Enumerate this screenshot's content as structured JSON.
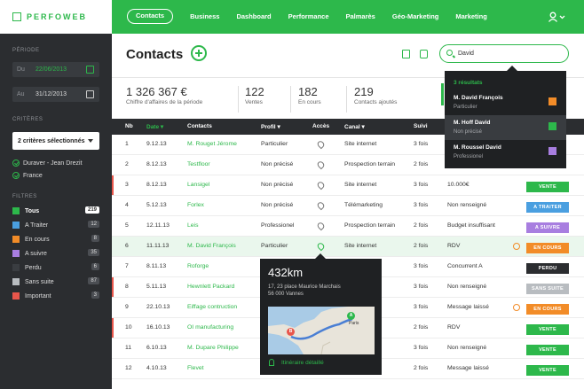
{
  "app": {
    "logo": "PERFOWEB"
  },
  "nav": [
    "Contacts",
    "Business",
    "Dashboard",
    "Performance",
    "Palmarès",
    "Géo-Marketing",
    "Marketing"
  ],
  "sidebar": {
    "period_label": "PÉRIODE",
    "from_label": "Du",
    "from_date": "22/06/2013",
    "to_label": "Au",
    "to_date": "31/12/2013",
    "criteria_label": "CRITÈRES",
    "criteria_select": "2 critères sélectionnés",
    "criteria": [
      "Duraver - Jean Drezit",
      "France"
    ],
    "filters_label": "FILTRES",
    "filters": [
      {
        "label": "Tous",
        "count": "219",
        "color": "#2db84b"
      },
      {
        "label": "A Traiter",
        "count": "12",
        "color": "#4a9fe0"
      },
      {
        "label": "En cours",
        "count": "8",
        "color": "#f28c28"
      },
      {
        "label": "A suivre",
        "count": "35",
        "color": "#a87ee0"
      },
      {
        "label": "Perdu",
        "count": "6",
        "color": "#3a3d41"
      },
      {
        "label": "Sans suite",
        "count": "87",
        "color": "#b8bcc0"
      },
      {
        "label": "Important",
        "count": "3",
        "color": "#e9564b"
      }
    ]
  },
  "page": {
    "title": "Contacts"
  },
  "search": {
    "value": "David"
  },
  "stats": [
    {
      "value": "1 326 367 €",
      "label": "Chiffre d'affaires de la période"
    },
    {
      "value": "122",
      "label": "Ventes"
    },
    {
      "value": "182",
      "label": "En cours"
    },
    {
      "value": "219",
      "label": "Contacts ajoutés"
    }
  ],
  "table": {
    "headers": [
      "Nb",
      "Date",
      "Contacts",
      "Profil",
      "Accès",
      "Canal",
      "Suivi"
    ],
    "rows": [
      {
        "nb": "1",
        "date": "9.12.13",
        "contact": "M. Rouget Jérome",
        "profil": "Particulier",
        "canal": "Site internet",
        "suivi": "3 fois",
        "note": "",
        "badge": "",
        "badge_color": "",
        "important": false
      },
      {
        "nb": "2",
        "date": "8.12.13",
        "contact": "Testfloor",
        "profil": "Non précisé",
        "canal": "Prospection terrain",
        "suivi": "2 fois",
        "note": "",
        "badge": "",
        "badge_color": "",
        "important": false
      },
      {
        "nb": "3",
        "date": "8.12.13",
        "contact": "Lansigel",
        "profil": "Non précisé",
        "canal": "Site internet",
        "suivi": "3 fois",
        "note": "10.000€",
        "badge": "VENTE",
        "badge_color": "#2db84b",
        "important": true
      },
      {
        "nb": "4",
        "date": "5.12.13",
        "contact": "Forlex",
        "profil": "Non précisé",
        "canal": "Télémarketing",
        "suivi": "3 fois",
        "note": "Non renseigné",
        "badge": "A TRAITER",
        "badge_color": "#4a9fe0",
        "important": false
      },
      {
        "nb": "5",
        "date": "12.11.13",
        "contact": "Leis",
        "profil": "Professionel",
        "canal": "Prospection terrain",
        "suivi": "2 fois",
        "note": "Budget insuffisant",
        "badge": "A SUIVRE",
        "badge_color": "#a87ee0",
        "important": false
      },
      {
        "nb": "6",
        "date": "11.11.13",
        "contact": "M. David François",
        "profil": "Particulier",
        "canal": "Site internet",
        "suivi": "2 fois",
        "note": "RDV",
        "badge": "EN COURS",
        "badge_color": "#f28c28",
        "important": false
      },
      {
        "nb": "7",
        "date": "8.11.13",
        "contact": "Roforge",
        "profil": "",
        "canal": "",
        "suivi": "3 fois",
        "note": "Concurrent A",
        "badge": "PERDU",
        "badge_color": "#2b2d30",
        "important": false
      },
      {
        "nb": "8",
        "date": "5.11.13",
        "contact": "Hewnlett Packard",
        "profil": "",
        "canal": "",
        "suivi": "3 fois",
        "note": "Non renseigné",
        "badge": "SANS SUITE",
        "badge_color": "#b8bcc0",
        "important": true
      },
      {
        "nb": "9",
        "date": "22.10.13",
        "contact": "Eiffage contruction",
        "profil": "",
        "canal": "",
        "suivi": "3 fois",
        "note": "Message laissé",
        "badge": "EN COURS",
        "badge_color": "#f28c28",
        "important": false
      },
      {
        "nb": "10",
        "date": "16.10.13",
        "contact": "OI manufacturing",
        "profil": "",
        "canal": "",
        "suivi": "2 fois",
        "note": "RDV",
        "badge": "VENTE",
        "badge_color": "#2db84b",
        "important": true
      },
      {
        "nb": "11",
        "date": "6.10.13",
        "contact": "M. Dupare Philippe",
        "profil": "",
        "canal": "",
        "suivi": "3 fois",
        "note": "Non renseigné",
        "badge": "VENTE",
        "badge_color": "#2db84b",
        "important": false
      },
      {
        "nb": "12",
        "date": "4.10.13",
        "contact": "Flevet",
        "profil": "",
        "canal": "",
        "suivi": "2 fois",
        "note": "Message laissé",
        "badge": "VENTE",
        "badge_color": "#2db84b",
        "important": false
      }
    ]
  },
  "dropdown": {
    "header": "3 résultats",
    "items": [
      {
        "name": "M. David François",
        "sub": "Particulier",
        "color": "#f28c28"
      },
      {
        "name": "M. Hoff David",
        "sub": "Non précisé",
        "color": "#2db84b"
      },
      {
        "name": "M. Roussel David",
        "sub": "Professionel",
        "color": "#a87ee0"
      }
    ]
  },
  "popup": {
    "distance": "432km",
    "address_line1": "17, 23 place Maurice Marchais",
    "address_line2": "56 000 Vannes",
    "map_label_a": "Paris",
    "map_label_a_short": "A",
    "map_label_b": "B",
    "link": "Itinéraire détaillé"
  }
}
